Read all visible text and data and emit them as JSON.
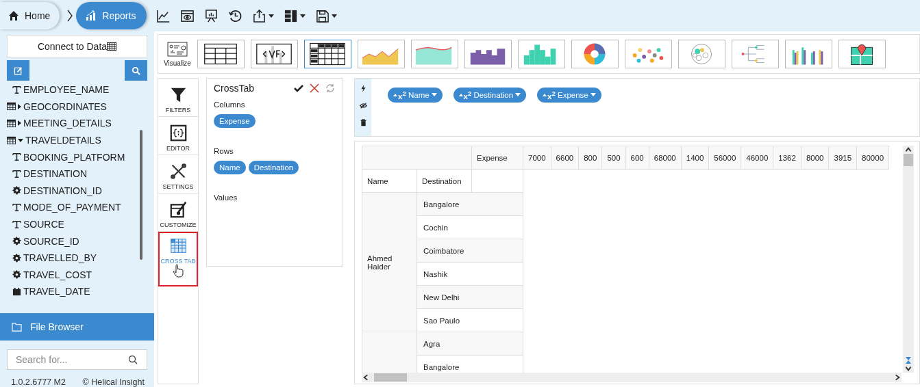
{
  "breadcrumb": [
    {
      "label": "Home",
      "kind": "home",
      "selected": false
    },
    {
      "label": "Reports",
      "kind": "reports",
      "selected": true
    }
  ],
  "sidebar": {
    "connect_button": "Connect to Data",
    "tree": [
      {
        "label": "EMPLOYEE_NAME",
        "kind": "text"
      },
      {
        "label": "GEOCORDINATES",
        "kind": "table",
        "expanded": false
      },
      {
        "label": "MEETING_DETAILS",
        "kind": "table",
        "expanded": false
      },
      {
        "label": "TRAVELDETAILS",
        "kind": "table",
        "expanded": true,
        "children": [
          {
            "label": "BOOKING_PLATFORM",
            "kind": "text"
          },
          {
            "label": "DESTINATION",
            "kind": "text"
          },
          {
            "label": "DESTINATION_ID",
            "kind": "number"
          },
          {
            "label": "MODE_OF_PAYMENT",
            "kind": "text"
          },
          {
            "label": "SOURCE",
            "kind": "text"
          },
          {
            "label": "SOURCE_ID",
            "kind": "number"
          },
          {
            "label": "TRAVELLED_BY",
            "kind": "number"
          },
          {
            "label": "TRAVEL_COST",
            "kind": "number"
          },
          {
            "label": "TRAVEL_DATE",
            "kind": "date"
          }
        ]
      }
    ],
    "file_browser": "File Browser",
    "search": {
      "placeholder": "Search for..."
    },
    "version": "1.0.2.6777 M2",
    "copyright": "© Helical Insight"
  },
  "visualize": {
    "label": "Visualize",
    "chart_types": [
      {
        "kind": "table",
        "selected": false
      },
      {
        "kind": "vf",
        "selected": false
      },
      {
        "kind": "crosstab",
        "selected": true
      },
      {
        "kind": "line-area",
        "selected": false
      },
      {
        "kind": "area",
        "selected": false
      },
      {
        "kind": "step",
        "selected": false
      },
      {
        "kind": "histogram",
        "selected": false
      },
      {
        "kind": "donut",
        "selected": false
      },
      {
        "kind": "scatter",
        "selected": false
      },
      {
        "kind": "pack",
        "selected": false
      },
      {
        "kind": "tree",
        "selected": false
      },
      {
        "kind": "grouped-bar",
        "selected": false
      },
      {
        "kind": "map",
        "selected": false
      }
    ]
  },
  "side_tabs": [
    {
      "label": "FILTERS",
      "kind": "filter",
      "selected": false
    },
    {
      "label": "EDITOR",
      "kind": "editor",
      "selected": false
    },
    {
      "label": "SETTINGS",
      "kind": "settings",
      "selected": false
    },
    {
      "label": "CUSTOMIZE",
      "kind": "customize",
      "selected": false
    },
    {
      "label": "CROSS TAB",
      "kind": "crosstab",
      "selected": true
    }
  ],
  "crosstab_panel": {
    "title": "CrossTab",
    "sections": [
      {
        "label": "Columns",
        "fields": [
          "Expense"
        ]
      },
      {
        "label": "Rows",
        "fields": [
          "Name",
          "Destination"
        ]
      },
      {
        "label": "Values"
      }
    ]
  },
  "filter_chips": [
    {
      "prefix": "x$^{2}$",
      "label": "Name"
    },
    {
      "prefix": "x$^{2}$",
      "label": "Destination"
    },
    {
      "prefix": "x$^{2}$",
      "label": "Expense"
    }
  ],
  "table": {
    "column_field": "Expense",
    "column_values": [
      "7000",
      "6600",
      "800",
      "500",
      "600",
      "68000",
      "1400",
      "56000",
      "46000",
      "1362",
      "8000",
      "3915",
      "80000"
    ],
    "row_fields": [
      "Name",
      "Destination"
    ],
    "groups": [
      {
        "name": "Ahmed Haider",
        "destinations": [
          "Bangalore",
          "Cochin",
          "Coimbatore",
          "Nashik",
          "New Delhi",
          "Sao Paulo"
        ]
      },
      {
        "destinations": [
          "Agra",
          "Bangalore"
        ]
      }
    ]
  }
}
